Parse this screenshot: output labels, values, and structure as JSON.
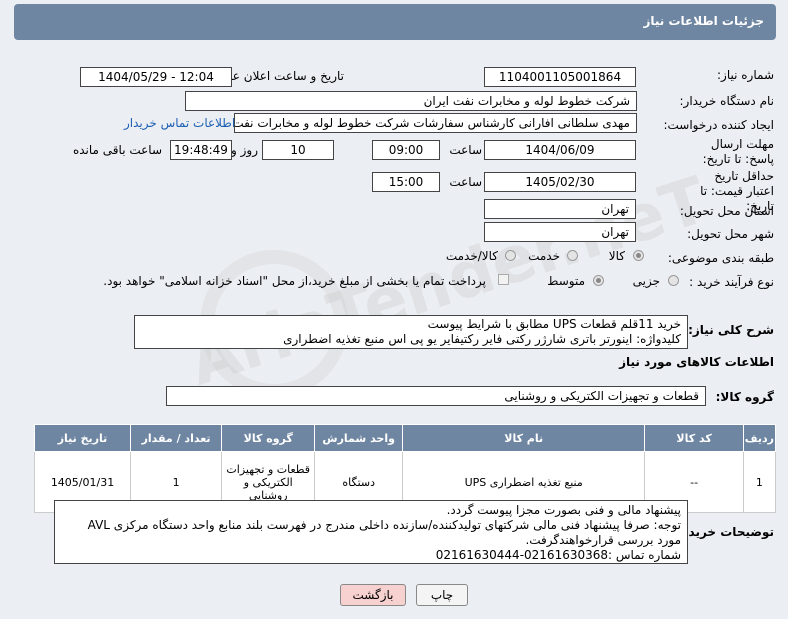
{
  "header": {
    "title": "جزئیات اطلاعات نیاز"
  },
  "form": {
    "need_number": {
      "label": "شماره نیاز:",
      "value": "1104001105001864"
    },
    "announce": {
      "label": "تاریخ و ساعت اعلان عمومی:",
      "value": "1404/05/29 - 12:04"
    },
    "buyer_org": {
      "label": "نام دستگاه خریدار:",
      "value": "شرکت خطوط لوله و مخابرات نفت ایران"
    },
    "requester": {
      "label": "ایجاد کننده درخواست:",
      "value": "مهدی سلطانی افارانی کارشناس سفارشات  شرکت خطوط لوله و مخابرات نفت",
      "contact_link": "اطلاعات تماس خریدار"
    },
    "reply_deadline": {
      "label": "مهلت ارسال پاسخ: تا تاریخ:",
      "date": "1404/06/09",
      "time_label": "ساعت",
      "time": "09:00",
      "days": "10",
      "days_label": "روز و",
      "remaining": "19:48:49",
      "remaining_label": "ساعت باقی مانده"
    },
    "price_validity": {
      "label": "حداقل تاریخ اعتبار قیمت: تا تاریخ:",
      "date": "1405/02/30",
      "time_label": "ساعت",
      "time": "15:00"
    },
    "province": {
      "label": "استان محل تحویل:",
      "value": "تهران"
    },
    "city": {
      "label": "شهر محل تحویل:",
      "value": "تهران"
    },
    "category": {
      "label": "طبقه بندی موضوعی:",
      "options": [
        "کالا",
        "خدمت",
        "کالا/خدمت"
      ],
      "selected": "کالا"
    },
    "purchase_type": {
      "label": "نوع فرآیند خرید :",
      "options": [
        "جزیی",
        "متوسط"
      ],
      "selected": "متوسط",
      "note": "پرداخت تمام یا بخشی از مبلغ خرید،از محل \"اسناد خزانه اسلامی\" خواهد بود."
    }
  },
  "description": {
    "label": "شرح کلی نیاز:",
    "line1": "خرید 11قلم قطعات UPS  مطابق با شرایط پیوست",
    "line2": "کلیدواژه: اینورتر باتری شارژر رکتی فایر رکتیفایر یو پی اس منبع تغذیه اضطراری"
  },
  "items_section": {
    "title": "اطلاعات کالاهای مورد نیاز",
    "group_label": "گروه کالا:",
    "group_value": "قطعات و تجهیزات الکتریکی و روشنایی"
  },
  "table": {
    "headers": [
      "ردیف",
      "کد کالا",
      "نام کالا",
      "واحد شمارش",
      "گروه کالا",
      "تعداد / مقدار",
      "تاریخ نیاز"
    ],
    "rows": [
      [
        "1",
        "--",
        "منبع تغذیه اضطراری UPS",
        "دستگاه",
        "قطعات و تجهیزات الکتریکی و روشنایی",
        "1",
        "1405/01/31"
      ]
    ]
  },
  "buyer_notes": {
    "label": "توضیحات خریدار:",
    "lines": [
      "پیشنهاد  مالی  و فنی بصورت مجزا پیوست گردد.",
      "توجه: صرفا پیشنهاد فنی مالی شرکتهای تولیدکننده/سازنده داخلی مندرج در فهرست بلند منابع واحد دستگاه مرکزی AVL",
      "مورد بررسی قرارخواهندگرفت.",
      "شماره تماس :02161630368-02161630444"
    ]
  },
  "buttons": {
    "print": "چاپ",
    "back": "بازگشت"
  },
  "watermark": "AriaTender.neT",
  "colors": {
    "header_bg": "#6f86a2",
    "link": "#1d5fb3",
    "back_btn": "#f7d0d0"
  }
}
